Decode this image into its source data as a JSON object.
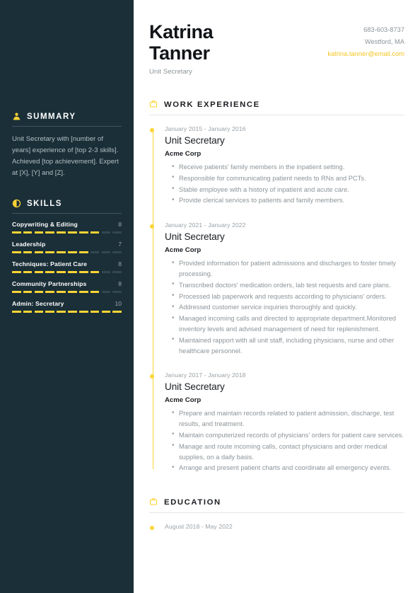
{
  "theme": {
    "sidebar_bg": "#1b2f38",
    "accent": "#fcd535",
    "email_color": "#f3c623",
    "muted_text": "#8d9499"
  },
  "header": {
    "first_name": "Katrina",
    "last_name": "Tanner",
    "role": "Unit Secretary",
    "phone": "683-603-8737",
    "location": "Westford, MA",
    "email": "katrina.tanner@email.com"
  },
  "sidebar": {
    "summary": {
      "title": "SUMMARY",
      "icon": "person-icon",
      "text": "Unit Secretary with [number of years] experience of [top 2-3 skills]. Achieved [top achievement]. Expert at [X], [Y] and [Z]."
    },
    "skills": {
      "title": "SKILLS",
      "icon": "pie-chart-icon",
      "max": 10,
      "items": [
        {
          "name": "Copywriting & Editing",
          "value": 8
        },
        {
          "name": "Leadership",
          "value": 7
        },
        {
          "name": "Techniques: Patient Care",
          "value": 8
        },
        {
          "name": "Community Partnerships",
          "value": 8
        },
        {
          "name": "Admin: Secretary",
          "value": 10
        }
      ]
    }
  },
  "main": {
    "work": {
      "title": "WORK EXPERIENCE",
      "icon": "briefcase-icon",
      "entries": [
        {
          "dates": "January 2015 - January 2016",
          "job_title": "Unit Secretary",
          "company": "Acme Corp",
          "bullets": [
            "Receive patients' family members in the inpatient setting.",
            "Responsible for communicating patient needs to RNs and PCTs.",
            "Stable employee with a history of inpatient and acute care.",
            "Provide clerical services to patients and family members."
          ]
        },
        {
          "dates": "January 2021 - January 2022",
          "job_title": "Unit Secretary",
          "company": "Acme Corp",
          "bullets": [
            "Provided information for patient admissions and discharges to foster timely processing.",
            "Transcribed doctors' medication orders, lab test requests and care plans.",
            "Processed lab paperwork and requests according to physicians' orders.",
            "Addressed customer service inquiries thoroughly and quickly.",
            "Managed incoming calls and directed to appropriate department.Monitored inventory levels and advised management of need for replenishment.",
            "Maintained rapport with all unit staff, including physicians, nurse and other healthcare personnel."
          ]
        },
        {
          "dates": "January 2017 - January 2018",
          "job_title": "Unit Secretary",
          "company": "Acme Corp",
          "bullets": [
            "Prepare and maintain records related to patient admission, discharge, test results, and treatment.",
            "Maintain computerized records of physicians' orders for patient care services.",
            "Manage and route incoming calls, contact physicians and order medical supplies, on a daily basis.",
            "Arrange and present patient charts and coordinate all emergency events."
          ]
        }
      ]
    },
    "education": {
      "title": "EDUCATION",
      "icon": "briefcase-icon",
      "entries": [
        {
          "dates": "August 2018 - May 2022"
        }
      ]
    }
  }
}
